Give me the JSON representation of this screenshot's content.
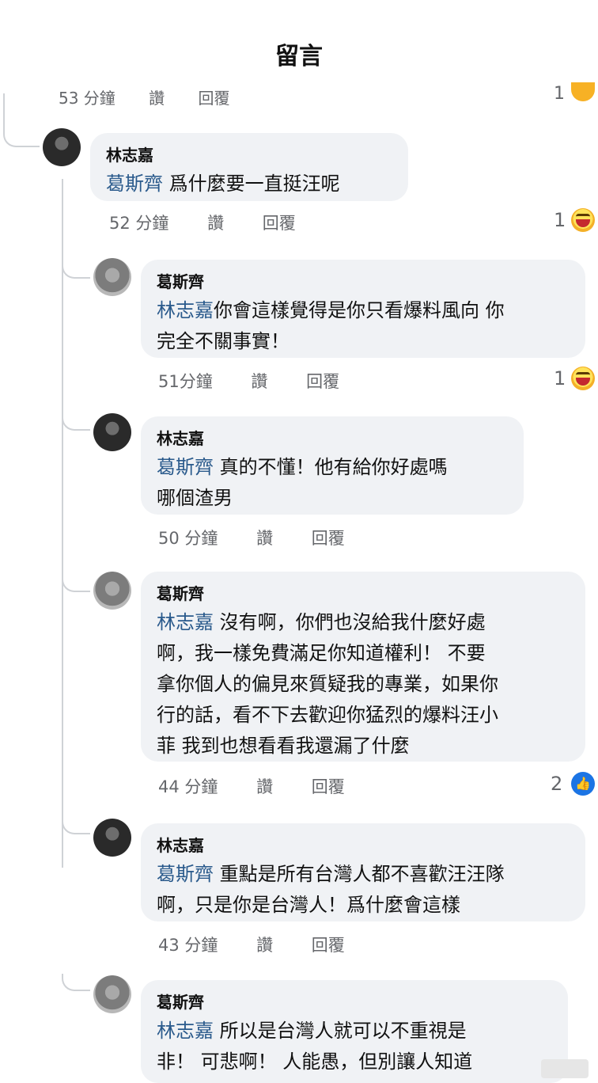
{
  "header": {
    "title": "留言"
  },
  "previous": {
    "time": "53 分鐘",
    "like": "讚",
    "reply": "回覆",
    "count": "1"
  },
  "comments": [
    {
      "author": "林志嘉",
      "mention": "葛斯齊",
      "lines": [
        " 爲什麼要一直挺汪呢"
      ],
      "time": "52 分鐘",
      "like": "讚",
      "reply": "回覆",
      "reactions": "1",
      "reaction_icon": "haha-emoji"
    },
    {
      "author": "葛斯齊",
      "mention": "林志嘉",
      "lines": [
        "你會這樣覺得是你只看爆料風向 你",
        "完全不關事實！"
      ],
      "time": "51分鐘",
      "like": "讚",
      "reply": "回覆",
      "reactions": "1",
      "reaction_icon": "haha-emoji"
    },
    {
      "author": "林志嘉",
      "mention": "葛斯齊",
      "lines": [
        " 真的不懂！他有給你好處嗎",
        "哪個渣男"
      ],
      "time": "50 分鐘",
      "like": "讚",
      "reply": "回覆",
      "reactions": "",
      "reaction_icon": ""
    },
    {
      "author": "葛斯齊",
      "mention": "林志嘉",
      "lines": [
        " 沒有啊，你們也沒給我什麼好處",
        "啊，我一樣免費滿足你知道權利！  不要",
        "拿你個人的偏見來質疑我的專業，如果你",
        "行的話，看不下去歡迎你猛烈的爆料汪小",
        "菲 我到也想看看我還漏了什麼"
      ],
      "time": "44 分鐘",
      "like": "讚",
      "reply": "回覆",
      "reactions": "2",
      "reaction_icon": "like-emoji"
    },
    {
      "author": "林志嘉",
      "mention": "葛斯齊",
      "lines": [
        " 重點是所有台灣人都不喜歡汪汪隊",
        "啊，只是你是台灣人！爲什麼會這樣"
      ],
      "time": "43 分鐘",
      "like": "讚",
      "reply": "回覆",
      "reactions": "",
      "reaction_icon": ""
    },
    {
      "author": "葛斯齊",
      "mention": "林志嘉",
      "lines": [
        " 所以是台灣人就可以不重視是",
        "非！  可悲啊！  人能愚，但別讓人知道"
      ],
      "time": "",
      "like": "",
      "reply": "",
      "reactions": "",
      "reaction_icon": ""
    }
  ]
}
